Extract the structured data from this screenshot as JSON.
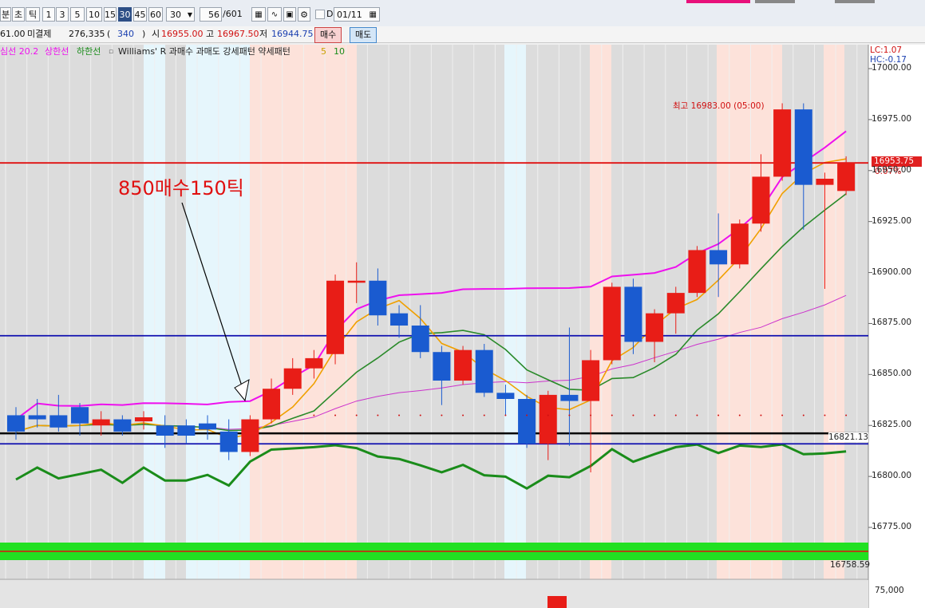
{
  "toolbar": {
    "period_buttons": [
      "분",
      "초",
      "틱",
      "1",
      "3",
      "5",
      "10",
      "15",
      "30",
      "45",
      "60"
    ],
    "selected_period": "30",
    "count_value": "30",
    "page_value": "56",
    "page_total": "/601",
    "date_value": "01/11",
    "checkbox_label": "D"
  },
  "quote": {
    "prev_value": "61.00",
    "open_interest_label": "미결제",
    "open_interest_value": "276,335",
    "oi_change": "340",
    "open_label": "시",
    "open_value": "16955.00",
    "high_label": "고",
    "high_value": "16967.50",
    "low_label": "저",
    "low_value": "16944.75",
    "buy_label": "매수",
    "sell_label": "매도",
    "paren_open": "(",
    "paren_close": ")"
  },
  "legend": {
    "item1": "심선 20.2",
    "item2": "상한선",
    "item3": "하한선",
    "item4": "Williams' R 과매수 과매도 강세패턴 약세패턴",
    "item5": "5",
    "item6": "10"
  },
  "status": {
    "lc": "LC:1.07",
    "hc": "HC:-0.17"
  },
  "annotation": {
    "text": "850매수150틱",
    "high_label": "최고 16983.00 (05:00)"
  },
  "price_box": {
    "value": "16953.75",
    "pct": "0.07%"
  },
  "chart_data": {
    "type": "candlestick",
    "ylim": [
      16750,
      17000
    ],
    "y_ticks": [
      "17000.00",
      "16975.00",
      "16950.00",
      "16925.00",
      "16900.00",
      "16875.00",
      "16850.00",
      "16825.00",
      "16800.00",
      "16775.00"
    ],
    "tick_values": [
      17000,
      16975,
      16950,
      16925,
      16900,
      16875,
      16850,
      16825,
      16800,
      16775
    ],
    "candles": [
      {
        "o": 16830,
        "c": 16822,
        "h": 16834,
        "l": 16818
      },
      {
        "o": 16830,
        "c": 16828,
        "h": 16838,
        "l": 16824
      },
      {
        "o": 16830,
        "c": 16824,
        "h": 16840,
        "l": 16822
      },
      {
        "o": 16834,
        "c": 16826,
        "h": 16836,
        "l": 16820
      },
      {
        "o": 16825,
        "c": 16828,
        "h": 16832,
        "l": 16820
      },
      {
        "o": 16828,
        "c": 16822,
        "h": 16830,
        "l": 16820
      },
      {
        "o": 16827,
        "c": 16829,
        "h": 16832,
        "l": 16823
      },
      {
        "o": 16825,
        "c": 16820,
        "h": 16830,
        "l": 16814
      },
      {
        "o": 16825,
        "c": 16820,
        "h": 16828,
        "l": 16816
      },
      {
        "o": 16826,
        "c": 16823,
        "h": 16830,
        "l": 16818
      },
      {
        "o": 16822,
        "c": 16812,
        "h": 16828,
        "l": 16808
      },
      {
        "o": 16812,
        "c": 16828,
        "h": 16830,
        "l": 16810
      },
      {
        "o": 16828,
        "c": 16843,
        "h": 16848,
        "l": 16826
      },
      {
        "o": 16843,
        "c": 16853,
        "h": 16858,
        "l": 16840
      },
      {
        "o": 16853,
        "c": 16858,
        "h": 16862,
        "l": 16848
      },
      {
        "o": 16860,
        "c": 16896,
        "h": 16899,
        "l": 16855
      },
      {
        "o": 16895,
        "c": 16896,
        "h": 16905,
        "l": 16885
      },
      {
        "o": 16896,
        "c": 16879,
        "h": 16902,
        "l": 16874
      },
      {
        "o": 16880,
        "c": 16874,
        "h": 16884,
        "l": 16868
      },
      {
        "o": 16874,
        "c": 16861,
        "h": 16884,
        "l": 16858
      },
      {
        "o": 16861,
        "c": 16847,
        "h": 16864,
        "l": 16835
      },
      {
        "o": 16847,
        "c": 16862,
        "h": 16864,
        "l": 16845
      },
      {
        "o": 16862,
        "c": 16841,
        "h": 16865,
        "l": 16839
      },
      {
        "o": 16841,
        "c": 16838,
        "h": 16845,
        "l": 16830
      },
      {
        "o": 16838,
        "c": 16816,
        "h": 16840,
        "l": 16814
      },
      {
        "o": 16816,
        "c": 16840,
        "h": 16842,
        "l": 16808
      },
      {
        "o": 16840,
        "c": 16837,
        "h": 16873,
        "l": 16815
      },
      {
        "o": 16837,
        "c": 16857,
        "h": 16862,
        "l": 16802
      },
      {
        "o": 16857,
        "c": 16893,
        "h": 16895,
        "l": 16855
      },
      {
        "o": 16893,
        "c": 16866,
        "h": 16897,
        "l": 16860
      },
      {
        "o": 16866,
        "c": 16880,
        "h": 16882,
        "l": 16856
      },
      {
        "o": 16880,
        "c": 16890,
        "h": 16893,
        "l": 16870
      },
      {
        "o": 16890,
        "c": 16911,
        "h": 16913,
        "l": 16888
      },
      {
        "o": 16911,
        "c": 16904,
        "h": 16929,
        "l": 16888
      },
      {
        "o": 16904,
        "c": 16924,
        "h": 16926,
        "l": 16902
      },
      {
        "o": 16924,
        "c": 16947,
        "h": 16958,
        "l": 16920
      },
      {
        "o": 16947,
        "c": 16980,
        "h": 16983,
        "l": 16945
      },
      {
        "o": 16980,
        "c": 16943,
        "h": 16983,
        "l": 16921
      },
      {
        "o": 16943,
        "c": 16946,
        "h": 16949,
        "l": 16892
      },
      {
        "o": 16940,
        "c": 16953.75,
        "h": 16957,
        "l": 16938
      }
    ],
    "hlines": [
      {
        "value": 16953.75,
        "color": "#e01010"
      },
      {
        "value": 16869,
        "color": "#1010b0"
      },
      {
        "value": 16816,
        "color": "#1010b0"
      },
      {
        "value": 16821.13,
        "color": "#000000"
      }
    ],
    "hline_labels": [
      "16821.13",
      "16758.59"
    ],
    "bottom_axis_label": "75,000",
    "colors": {
      "up": "#e81d17",
      "down": "#1a5bd0",
      "ma_fast": "#f0a000",
      "upper": "#ee10ee",
      "lower": "#2a8a2a",
      "williams": "#1a8c1a"
    }
  }
}
